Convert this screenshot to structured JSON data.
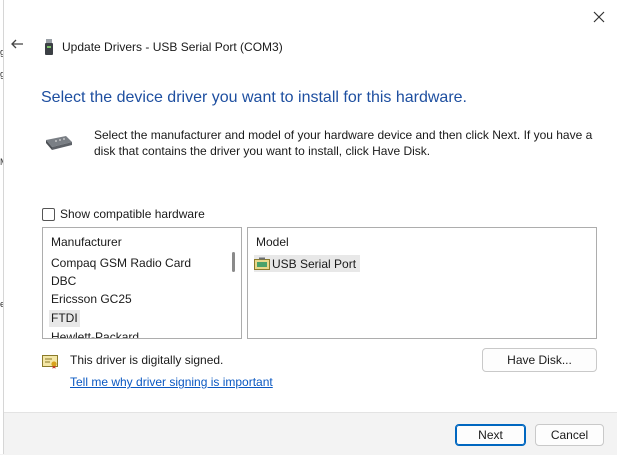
{
  "window": {
    "title": "Update Drivers - USB Serial Port (COM3)"
  },
  "header": {
    "heading": "Select the device driver you want to install for this hardware.",
    "description": "Select the manufacturer and model of your hardware device and then click Next. If you have a disk that contains the driver you want to install, click Have Disk."
  },
  "compatible": {
    "label": "Show compatible hardware",
    "checked": false
  },
  "manufacturer_list": {
    "header": "Manufacturer",
    "items": [
      "Compaq GSM Radio Card",
      "DBC",
      "Ericsson GC25",
      "FTDI",
      "Hewlett-Packard"
    ],
    "selected": "FTDI"
  },
  "model_list": {
    "header": "Model",
    "items": [
      "USB Serial Port"
    ],
    "selected": "USB Serial Port"
  },
  "signing": {
    "status": "This driver is digitally signed.",
    "link": "Tell me why driver signing is important"
  },
  "buttons": {
    "have_disk": "Have Disk...",
    "next": "Next",
    "cancel": "Cancel"
  },
  "colors": {
    "heading": "#1e4fa0",
    "link": "#0a58c2",
    "default_button_border": "#0067c0"
  },
  "icons": {
    "close": "close-icon",
    "back": "back-arrow-icon",
    "title": "usb-device-icon",
    "device": "serial-cable-icon",
    "model": "driver-package-icon",
    "signed": "certificate-icon"
  }
}
